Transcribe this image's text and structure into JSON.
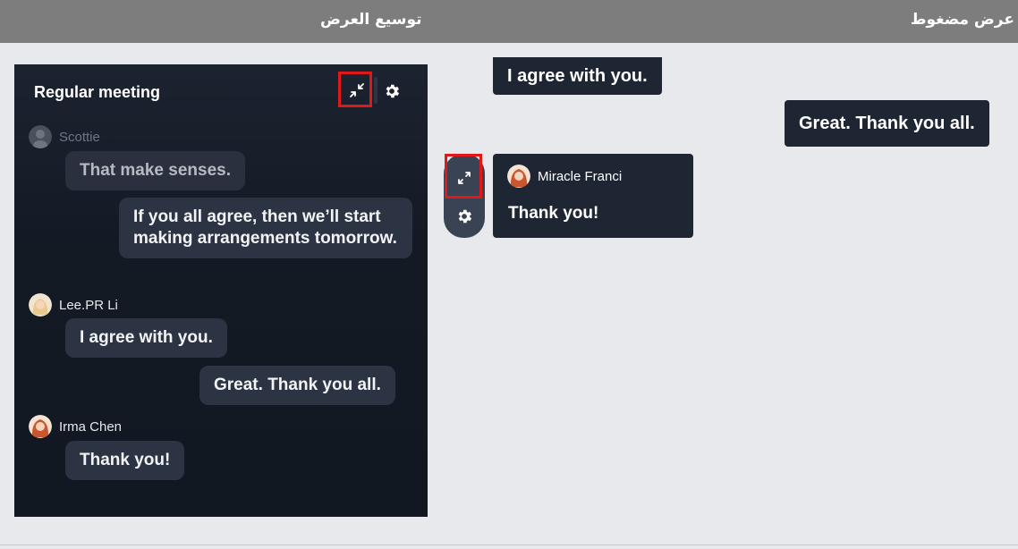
{
  "topbar": {
    "expanded_label": "توسيع العرض",
    "compact_label": "عرض مضغوط"
  },
  "panel": {
    "title": "Regular meeting",
    "messages": [
      {
        "sender": "Scottie",
        "text": "That make senses."
      },
      {
        "text": "If you all agree, then we’ll start making arrangements tomorrow."
      },
      {
        "sender": "Lee.PR Li",
        "text": "I agree with you."
      },
      {
        "text": "Great. Thank you all."
      },
      {
        "sender": "Irma Chen",
        "text": "Thank you!"
      }
    ]
  },
  "compact": {
    "prev_bubble": "I agree with you.",
    "self_bubble": "Great. Thank you all.",
    "card": {
      "sender": "Miracle Franci",
      "text": "Thank you!"
    }
  },
  "icons": [
    "shrink-icon",
    "gear-icon",
    "expand-icon",
    "avatar"
  ],
  "colors": {
    "panel_bg": "#141a24",
    "bubble_bg": "#2c3444",
    "highlight": "#e01818",
    "page_bg": "#e8e9ec",
    "topbar_bg": "#7d7d7d"
  }
}
